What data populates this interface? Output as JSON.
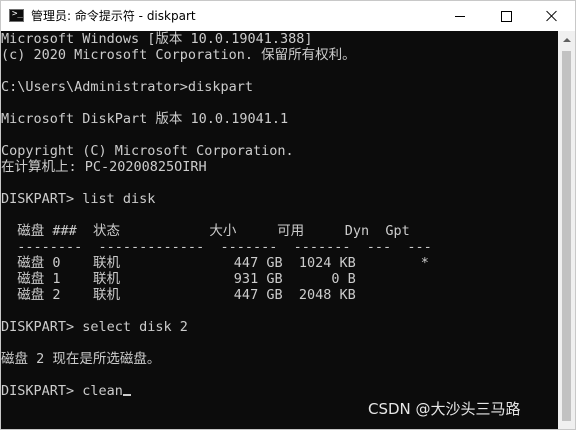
{
  "window": {
    "title": "管理员: 命令提示符 - diskpart"
  },
  "console": {
    "lines": [
      "Microsoft Windows [版本 10.0.19041.388]",
      "(c) 2020 Microsoft Corporation. 保留所有权利。",
      "",
      "C:\\Users\\Administrator>diskpart",
      "",
      "Microsoft DiskPart 版本 10.0.19041.1",
      "",
      "Copyright (C) Microsoft Corporation.",
      "在计算机上: PC-20200825OIRH",
      "",
      "DISKPART> list disk",
      "",
      "  磁盘 ###  状态           大小     可用     Dyn  Gpt",
      "  --------  -------------  -------  -------  ---  ---",
      "  磁盘 0    联机              447 GB  1024 KB        *",
      "  磁盘 1    联机              931 GB      0 B",
      "  磁盘 2    联机              447 GB  2048 KB",
      "",
      "DISKPART> select disk 2",
      "",
      "磁盘 2 现在是所选磁盘。",
      "",
      "DISKPART> clean"
    ]
  },
  "watermark": "CSDN @大沙头三马路",
  "icons": {
    "app": "cmd-icon",
    "minimize": "minimize-icon",
    "maximize": "maximize-icon",
    "close": "close-icon",
    "scroll_up": "chevron-up-icon"
  },
  "colors": {
    "console_bg": "#0c0c0c",
    "console_fg": "#cccccc",
    "titlebar_bg": "#ffffff",
    "scrollbar_bg": "#f0f0f0",
    "scrollbar_thumb": "#c2c2c2"
  }
}
